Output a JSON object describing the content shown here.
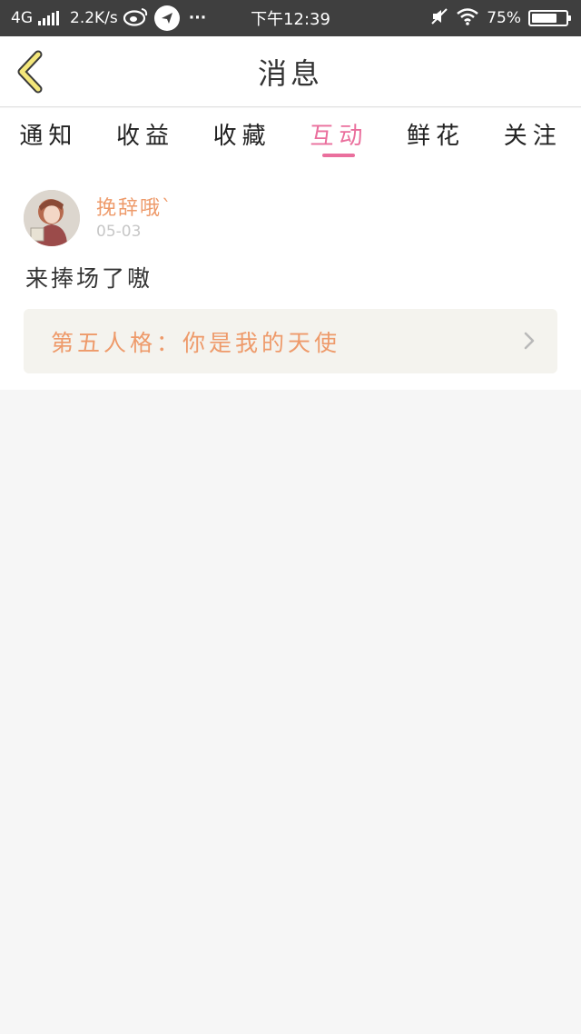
{
  "status_bar": {
    "network": "4G",
    "speed": "2.2K/s",
    "more": "···",
    "time": "下午12:39",
    "battery": "75%",
    "battery_level": 0.75
  },
  "header": {
    "title": "消息"
  },
  "tabs": [
    {
      "label": "通知",
      "active": false
    },
    {
      "label": "收益",
      "active": false
    },
    {
      "label": "收藏",
      "active": false
    },
    {
      "label": "互动",
      "active": true
    },
    {
      "label": "鲜花",
      "active": false
    },
    {
      "label": "关注",
      "active": false
    }
  ],
  "message": {
    "username": "挽辞哦`",
    "date": "05-03",
    "text": "来捧场了嗷",
    "link_title": "第五人格：你是我的天使"
  },
  "colors": {
    "accent": "#ea6f9d",
    "username": "#ee9a6a",
    "status_bar": "#3f3f3f"
  }
}
